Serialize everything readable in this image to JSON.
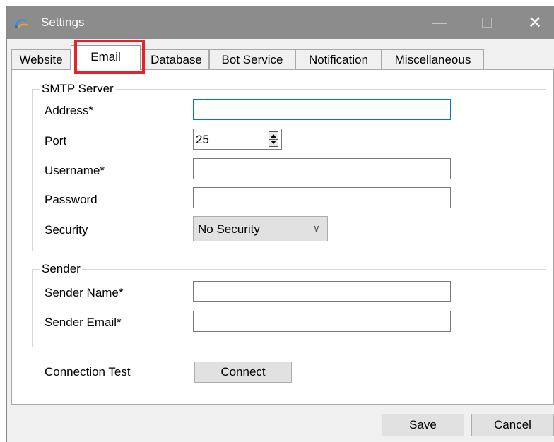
{
  "window": {
    "title": "Settings",
    "minimize_glyph": "—",
    "close_glyph": "✕",
    "icon": "app-icon"
  },
  "tabs": [
    {
      "label": "Website",
      "active": false
    },
    {
      "label": "Email",
      "active": true
    },
    {
      "label": "Database",
      "active": false
    },
    {
      "label": "Bot Service",
      "active": false
    },
    {
      "label": "Notification",
      "active": false
    },
    {
      "label": "Miscellaneous",
      "active": false
    }
  ],
  "smtp": {
    "legend": "SMTP Server",
    "address_label": "Address*",
    "address_value": "",
    "port_label": "Port",
    "port_value": "25",
    "username_label": "Username*",
    "username_value": "",
    "password_label": "Password",
    "password_value": "",
    "security_label": "Security",
    "security_value": "No Security"
  },
  "sender": {
    "legend": "Sender",
    "name_label": "Sender Name*",
    "name_value": "",
    "email_label": "Sender Email*",
    "email_value": ""
  },
  "connection": {
    "label": "Connection Test",
    "button": "Connect"
  },
  "footer": {
    "save": "Save",
    "cancel": "Cancel"
  },
  "colors": {
    "titlebar": "#8c8c8c",
    "highlight": "#e8202a",
    "focus": "#0078d7"
  }
}
